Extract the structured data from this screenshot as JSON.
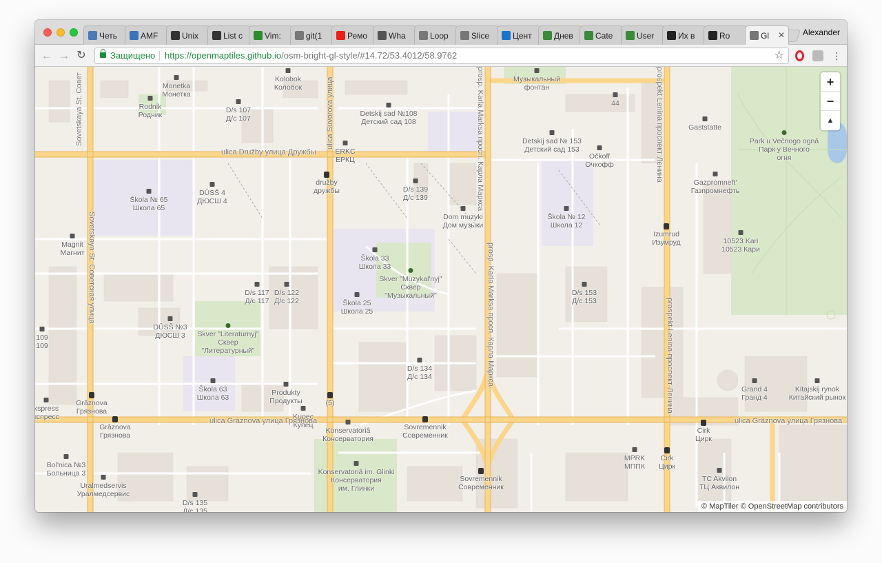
{
  "window": {
    "profile_name": "Alexander"
  },
  "tabs": [
    {
      "label": "Четь",
      "icon": "h-icon",
      "color": "#4a7bb5"
    },
    {
      "label": "AMF",
      "icon": "chat-icon",
      "color": "#3b73b9"
    },
    {
      "label": "Unix",
      "icon": "wikipedia-icon",
      "color": "#333333"
    },
    {
      "label": "List c",
      "icon": "wikipedia-icon",
      "color": "#333333"
    },
    {
      "label": "Vim:",
      "icon": "vim-icon",
      "color": "#2e8b2e"
    },
    {
      "label": "git(1",
      "icon": "document-icon",
      "color": "#777777"
    },
    {
      "label": "Ремо",
      "icon": "youtube-icon",
      "color": "#e62117"
    },
    {
      "label": "Wha",
      "icon": "star-icon",
      "color": "#555555"
    },
    {
      "label": "Loop",
      "icon": "document-icon",
      "color": "#777777"
    },
    {
      "label": "Slice",
      "icon": "document-icon",
      "color": "#777777"
    },
    {
      "label": "Цент",
      "icon": "drop-icon",
      "color": "#1a73c8"
    },
    {
      "label": "Днев",
      "icon": "tools-icon",
      "color": "#3a8a3a"
    },
    {
      "label": "Cate",
      "icon": "tools-icon",
      "color": "#3a8a3a"
    },
    {
      "label": "User",
      "icon": "tools-icon",
      "color": "#3a8a3a"
    },
    {
      "label": "Их в",
      "icon": "m-icon",
      "color": "#222222"
    },
    {
      "label": "Ro",
      "icon": "play-icon",
      "color": "#222222"
    },
    {
      "label": "Gl",
      "icon": "document-icon",
      "color": "#777777",
      "active": true
    }
  ],
  "toolbar": {
    "back_icon": "back-arrow-icon",
    "forward_icon": "forward-arrow-icon",
    "reload_icon": "reload-icon",
    "secure_label": "Защищено",
    "url_host": "https://openmaptiles.github.io",
    "url_path": "/osm-bright-gl-style/#14.72/53.4012/58.9762"
  },
  "map": {
    "zoom_in": "+",
    "zoom_out": "−",
    "compass": "▲",
    "attribution": "© MapTiler © OpenStreetMap contributors",
    "roads": {
      "druzhby": "ulica Družby улица Дружбы",
      "graznova_left": "ulica Grâznova улица Грязнова",
      "graznova_right": "ulica Grâznova улица Грязнова",
      "sovetskaya_top": "Sovetskaya St. Совет",
      "sovetskaya": "Sovetskaya St. Советская улица",
      "suvorova": "ulica Suvorova улица",
      "karla_marksa_top": "prosp. Karla Marksa просп. Карла Маркса",
      "karla_marksa": "prosp. Karla Marksa просп. Карла Маркса",
      "lenina_top": "prospekt Lenina проспект Ленина",
      "lenina": "prospekt Lenina проспект Ленина"
    },
    "labels": [
      {
        "id": "kolobok",
        "lines": [
          "Kolobok",
          "Колобок"
        ]
      },
      {
        "id": "monetka",
        "lines": [
          "Monetka",
          "Монетка"
        ]
      },
      {
        "id": "rodnik",
        "lines": [
          "Rodnik",
          "Родник"
        ]
      },
      {
        "id": "ds107",
        "lines": [
          "D/s 107",
          "Д/с 107"
        ]
      },
      {
        "id": "ds108",
        "lines": [
          "Detskij sad №108",
          "Детский сад 108"
        ]
      },
      {
        "id": "muz_fontan",
        "lines": [
          "Музыкальный",
          "фонтан"
        ]
      },
      {
        "id": "n44",
        "lines": [
          "44"
        ]
      },
      {
        "id": "ds153a",
        "lines": [
          "Detskij sad № 153",
          "Детский сад  153"
        ]
      },
      {
        "id": "ockoff",
        "lines": [
          "Očkoff",
          "Очкофф"
        ]
      },
      {
        "id": "gaststatte",
        "lines": [
          "Gaststatte"
        ]
      },
      {
        "id": "park",
        "lines": [
          "Park u Večnogo ognâ",
          "Парк у Вечного",
          "огня"
        ]
      },
      {
        "id": "erkc",
        "lines": [
          "ERKC",
          "ЕРКЦ"
        ]
      },
      {
        "id": "druzhby_stop",
        "lines": [
          "družby",
          "дружбы"
        ]
      },
      {
        "id": "gazpromneft",
        "lines": [
          "Gazpromneft'",
          "Газпромнефть"
        ]
      },
      {
        "id": "skola65",
        "lines": [
          "Škola № 65",
          "Школа  65"
        ]
      },
      {
        "id": "dyush4",
        "lines": [
          "DÛSŠ 4",
          "ДЮСШ 4"
        ]
      },
      {
        "id": "ds139",
        "lines": [
          "D/s 139",
          "Д/с 139"
        ]
      },
      {
        "id": "dom_muzyki",
        "lines": [
          "Dom muzyki",
          "Дом музыки"
        ]
      },
      {
        "id": "skola12",
        "lines": [
          "Škola № 12",
          "Школа  12"
        ]
      },
      {
        "id": "izumrud",
        "lines": [
          "Izumrud",
          "Изумруд"
        ]
      },
      {
        "id": "kari",
        "lines": [
          "10523 Kari",
          "10523 Кари"
        ]
      },
      {
        "id": "magnit",
        "lines": [
          "Magnit",
          "Магнит"
        ]
      },
      {
        "id": "skola33",
        "lines": [
          "Škola 33",
          "Школа 33"
        ]
      },
      {
        "id": "skver_muz",
        "lines": [
          "Skver \"Muzykal'nyj\"",
          "Сквер",
          "\"Музыкальный\""
        ]
      },
      {
        "id": "ds153b",
        "lines": [
          "D/s 153",
          "Д/с 153"
        ]
      },
      {
        "id": "ds117",
        "lines": [
          "D/s 117",
          "Д/с 117"
        ]
      },
      {
        "id": "ds122",
        "lines": [
          "D/s 122",
          "Д/с 122"
        ]
      },
      {
        "id": "skola25",
        "lines": [
          "Škola 25",
          "Школа 25"
        ]
      },
      {
        "id": "n109",
        "lines": [
          "109",
          "109"
        ]
      },
      {
        "id": "dyush3",
        "lines": [
          "DÛSŠ №3",
          "ДЮСШ 3"
        ]
      },
      {
        "id": "skver_lit",
        "lines": [
          "Skver \"Literaturnyj\"",
          "Сквер",
          "\"Литературный\""
        ]
      },
      {
        "id": "ds134",
        "lines": [
          "D/s 134",
          "Д/с 134"
        ]
      },
      {
        "id": "grand4",
        "lines": [
          "Grand 4",
          "Гранд 4"
        ]
      },
      {
        "id": "kitajskij",
        "lines": [
          "Kitajskij rynok",
          "Китайский рынок"
        ]
      },
      {
        "id": "skola63",
        "lines": [
          "Škola 63",
          "Школа 63"
        ]
      },
      {
        "id": "produkty",
        "lines": [
          "Produkty",
          "Продукты"
        ]
      },
      {
        "id": "n5",
        "lines": [
          "(5)"
        ]
      },
      {
        "id": "graznova_stop",
        "lines": [
          "Grâznova",
          "Грязнова"
        ]
      },
      {
        "id": "express",
        "lines": [
          "kspress",
          "кспресс"
        ]
      },
      {
        "id": "kupec",
        "lines": [
          "Kupec",
          "Купец"
        ]
      },
      {
        "id": "graznova_stop2",
        "lines": [
          "Grâznova",
          "Грязнова"
        ]
      },
      {
        "id": "konservatoria",
        "lines": [
          "Konservatoriâ",
          "Консерватория"
        ]
      },
      {
        "id": "sovremennik1",
        "lines": [
          "Sovremennik",
          "Современник"
        ]
      },
      {
        "id": "cirk1",
        "lines": [
          "Cirk",
          "Цирк"
        ]
      },
      {
        "id": "bolnica",
        "lines": [
          "Bol'nica №3",
          "Больница 3"
        ]
      },
      {
        "id": "konservatoria_glinki",
        "lines": [
          "Konservatoriâ im. Glinki",
          "Консерватория",
          "им. Глинки"
        ]
      },
      {
        "id": "mprk",
        "lines": [
          "MPRK",
          "МППК"
        ]
      },
      {
        "id": "cirk2",
        "lines": [
          "Cirk",
          "Цирк"
        ]
      },
      {
        "id": "ural",
        "lines": [
          "Uralmedservis",
          "Уралмедсервис"
        ]
      },
      {
        "id": "sovremennik2",
        "lines": [
          "Sovremennik",
          "Современник"
        ]
      },
      {
        "id": "akvilon",
        "lines": [
          "TC Akvilon",
          "ТЦ Аквилон"
        ]
      },
      {
        "id": "ds135",
        "lines": [
          "D/s 135",
          "Д/с 135"
        ]
      }
    ]
  }
}
